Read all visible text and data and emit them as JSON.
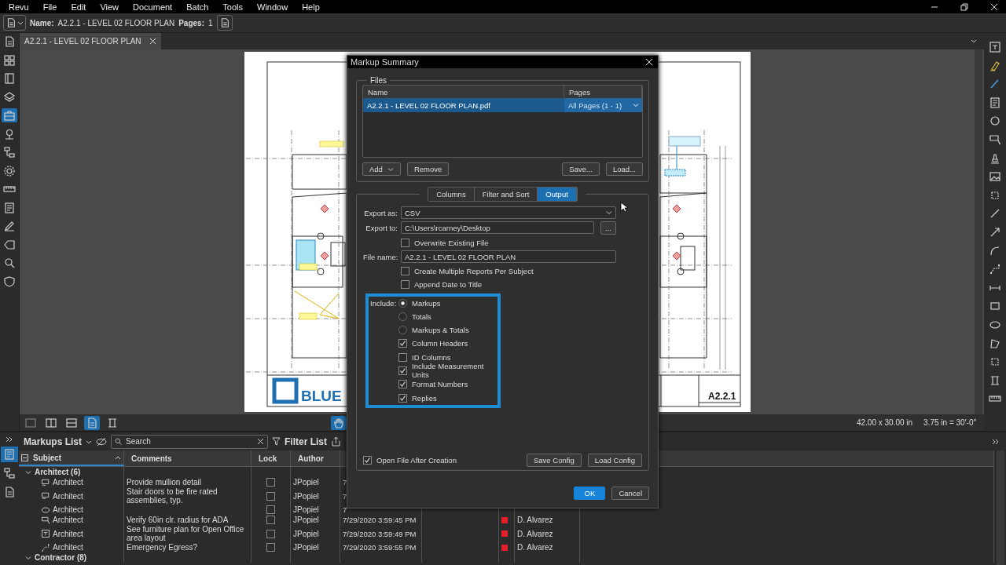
{
  "menu_bar": [
    "Revu",
    "File",
    "Edit",
    "View",
    "Document",
    "Batch",
    "Tools",
    "Window",
    "Help"
  ],
  "toolbar": {
    "name_label": "Name:",
    "name_value": "A2.2.1 - LEVEL 02 FLOOR PLAN",
    "pages_label": "Pages:",
    "pages_value": "1"
  },
  "side_panel_tabs": [
    {
      "selected": false
    },
    {
      "selected": false
    },
    {
      "selected": false
    },
    {
      "selected": false
    },
    {
      "selected": true
    },
    {
      "selected": false
    },
    {
      "selected": false
    },
    {
      "selected": false
    },
    {
      "selected": false
    },
    {
      "selected": false
    },
    {
      "selected": false
    },
    {
      "selected": false
    },
    {
      "selected": false
    },
    {
      "selected": false
    }
  ],
  "document_tabs": [
    {
      "label": "A2.2.1 - LEVEL 02 FLOOR PLAN",
      "selected": true
    }
  ],
  "sheet": {
    "logo_text": "BLUE",
    "sheet_number": "A2.2.1"
  },
  "view_buttons": [
    {
      "selected": false
    },
    {
      "selected": false
    },
    {
      "selected": false
    },
    {
      "selected": true
    },
    {
      "selected": false
    },
    {
      "selected": true
    }
  ],
  "status": {
    "page_size": "42.00 x 30.00 in",
    "scale": "3.75 in = 30'-0\""
  },
  "markup_panel_tabs": [
    {
      "selected": true
    },
    {
      "selected": false
    },
    {
      "selected": false
    }
  ],
  "markups_panel": {
    "title": "Markups List",
    "search": {
      "placeholder": "Search"
    },
    "filter_label": "Filter List",
    "columns": [
      "Subject",
      "Comments",
      "Lock",
      "Author"
    ],
    "groups": [
      {
        "label": "Architect (6)",
        "expanded": true,
        "rows": [
          {
            "kind": "cloud",
            "subject": "Architect",
            "comment": "Provide mullion detail",
            "locked": false,
            "author": "JPopiel",
            "column_5": "7"
          },
          {
            "kind": "cloud",
            "subject": "Architect",
            "comment": "Stair doors to be fire rated assemblies, typ.",
            "locked": false,
            "author": "JPopiel",
            "column_5": "7"
          },
          {
            "kind": "ellipse",
            "subject": "Architect",
            "locked": false,
            "author": "JPopiel",
            "column_5": "7"
          },
          {
            "kind": "callout",
            "subject": "Architect",
            "comment": "Verify 60in clr. radius for ADA",
            "locked": false,
            "author": "JPopiel",
            "column_5": "7/29/2020 3:59:45 PM",
            "color": "#e3202a",
            "column_8": "D. Alvarez"
          },
          {
            "kind": "textbox",
            "subject": "Architect",
            "comment": "See furniture plan for Open Office area layout",
            "locked": false,
            "author": "JPopiel",
            "column_5": "7/29/2020 3:59:49 PM",
            "color": "#e3202a",
            "column_8": "D. Alvarez"
          },
          {
            "kind": "polyline",
            "subject": "Architect",
            "comment": "Emergency Egress?",
            "locked": false,
            "author": "JPopiel",
            "column_5": "7/29/2020 3:59:55 PM",
            "color": "#e3202a",
            "column_8": "D. Alvarez"
          }
        ]
      },
      {
        "label": "Contractor (8)",
        "expanded": true
      }
    ]
  },
  "dialog": {
    "title": "Markup Summary",
    "files": {
      "legend": "Files",
      "columns": [
        "Name",
        "Pages"
      ],
      "rows": [
        {
          "name": "A2.2.1 - LEVEL 02 FLOOR PLAN.pdf",
          "pages": "All Pages (1 - 1)",
          "selected": true
        }
      ],
      "left_buttons": [
        {
          "label": "Add",
          "dropdown": true
        },
        {
          "label": "Remove",
          "dropdown": false
        }
      ],
      "right_buttons": [
        "Save...",
        "Load..."
      ]
    },
    "tabs": [
      {
        "label": "Columns",
        "selected": false
      },
      {
        "label": "Filter and Sort",
        "selected": false
      },
      {
        "label": "Output",
        "selected": true
      }
    ],
    "fields": [
      {
        "kind": "select",
        "label": "Export as:",
        "value": "CSV"
      },
      {
        "kind": "path",
        "label": "Export to:",
        "value": "C:\\Users\\rcarney\\Desktop",
        "button": "..."
      },
      {
        "kind": "checkbox",
        "label": "Overwrite Existing File",
        "checked": false
      },
      {
        "kind": "text",
        "label": "File name:",
        "value": "A2.2.1 - LEVEL 02 FLOOR PLAN"
      },
      {
        "kind": "checkbox",
        "label": "Create Multiple Reports Per Subject",
        "checked": false
      },
      {
        "kind": "checkbox",
        "label": "Append Date to Title",
        "checked": false
      }
    ],
    "include": {
      "label": "Include:",
      "highlighted": true,
      "options": [
        {
          "kind": "radio",
          "label": "Markups",
          "selected": true
        },
        {
          "kind": "radio",
          "label": "Totals",
          "selected": false
        },
        {
          "kind": "radio",
          "label": "Markups & Totals",
          "selected": false
        },
        {
          "kind": "checkbox",
          "label": "Column Headers",
          "checked": true
        },
        {
          "kind": "checkbox",
          "label": "ID Columns",
          "checked": false
        },
        {
          "kind": "checkbox",
          "label": "Include Measurement Units",
          "checked": true
        },
        {
          "kind": "checkbox",
          "label": "Format Numbers",
          "checked": true
        },
        {
          "kind": "checkbox",
          "label": "Replies",
          "checked": true
        }
      ]
    },
    "open_after": {
      "label": "Open File After Creation",
      "checked": true
    },
    "config_buttons": [
      "Save Config",
      "Load Config"
    ],
    "buttons": [
      {
        "label": "OK",
        "primary": true
      },
      {
        "label": "Cancel",
        "primary": false
      }
    ]
  }
}
